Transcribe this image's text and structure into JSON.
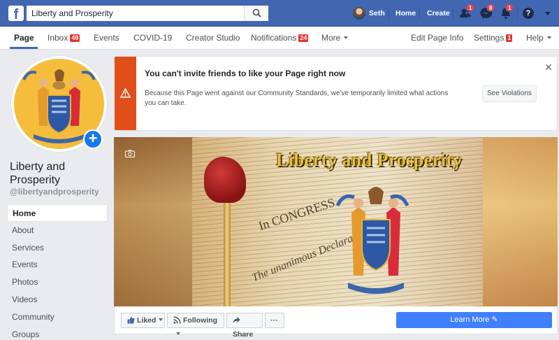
{
  "topbar": {
    "search_value": "Liberty and Prosperity",
    "user_name": "Seth",
    "home_label": "Home",
    "create_label": "Create",
    "friends_badge": "1",
    "messages_badge": "8",
    "notifications_badge": "1",
    "help_label": "?"
  },
  "tabs": {
    "page": "Page",
    "inbox": "Inbox",
    "inbox_count": "49",
    "events": "Events",
    "covid": "COVID-19",
    "creator_studio": "Creator Studio",
    "notifications": "Notifications",
    "notifications_count": "24",
    "more": "More",
    "edit_page_info": "Edit Page Info",
    "settings": "Settings",
    "settings_count": "1",
    "help": "Help"
  },
  "profile": {
    "name": "Liberty and Prosperity",
    "handle": "@libertyandprosperity",
    "add_symbol": "+"
  },
  "leftnav": {
    "items": [
      "Home",
      "About",
      "Services",
      "Events",
      "Photos",
      "Videos",
      "Community",
      "Groups"
    ]
  },
  "alert": {
    "title": "You can't invite friends to like your Page right now",
    "body": "Because this Page went against our Community Standards, we've temporarily limited what actions you can take.",
    "button": "See Violations",
    "close": "✕"
  },
  "cover": {
    "title": "Liberty and Prosperity",
    "congress_text": "In CONGRESS",
    "unanimous_text": "The unanimous Declaration"
  },
  "actions": {
    "liked": "Liked",
    "following": "Following",
    "share": "Share",
    "more": "···",
    "learn_more": "Learn More ✎"
  },
  "colors": {
    "brand": "#4267b2",
    "alert_strip": "#e04f1a",
    "badge": "#fa3e3e",
    "learn_more": "#4080ff"
  }
}
